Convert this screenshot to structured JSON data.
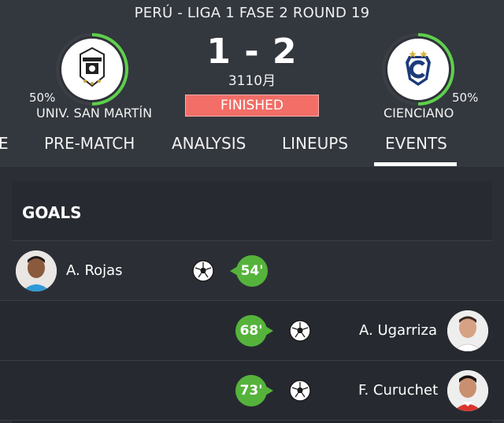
{
  "match": {
    "league": "PERÚ - LIGA 1 FASE 2 ROUND 19",
    "score": "1 - 2",
    "date": "3110月",
    "status": "FINISHED",
    "status_color": "#f26e67",
    "accent_color": "#5ed04c"
  },
  "home": {
    "name": "UNIV. SAN MARTÍN",
    "possession": "50%",
    "logo_icon": "univ-san-martin-crest"
  },
  "away": {
    "name": "CIENCIANO",
    "possession": "50%",
    "logo_icon": "cienciano-crest"
  },
  "tabs": [
    {
      "label": "E"
    },
    {
      "label": "PRE-MATCH"
    },
    {
      "label": "ANALYSIS"
    },
    {
      "label": "LINEUPS"
    },
    {
      "label": "EVENTS",
      "active": true
    }
  ],
  "goals": {
    "title": "GOALS",
    "events": [
      {
        "side": "home",
        "player": "A. Rojas",
        "minute": "54'",
        "icon": "soccer-ball-icon"
      },
      {
        "side": "away",
        "player": "A. Ugarriza",
        "minute": "68'",
        "icon": "soccer-ball-icon"
      },
      {
        "side": "away",
        "player": "F. Curuchet",
        "minute": "73'",
        "icon": "soccer-ball-icon"
      }
    ]
  }
}
